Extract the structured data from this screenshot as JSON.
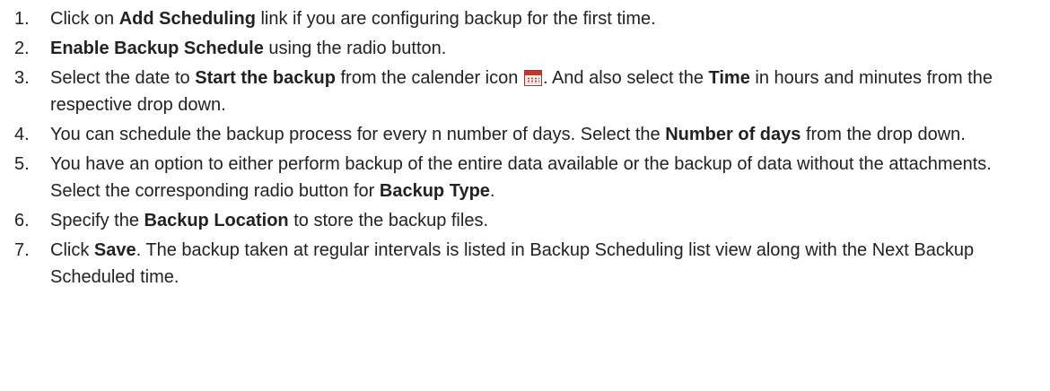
{
  "steps": [
    {
      "num": "1.",
      "parts": [
        {
          "t": "Click on "
        },
        {
          "t": "Add Scheduling",
          "b": true
        },
        {
          "t": " link if you are configuring backup for the first time."
        }
      ]
    },
    {
      "num": "2.",
      "parts": [
        {
          "t": "Enable Backup Schedule",
          "b": true
        },
        {
          "t": " using the radio button."
        }
      ]
    },
    {
      "num": "3.",
      "parts": [
        {
          "t": "Select the date to "
        },
        {
          "t": "Start the backup",
          "b": true
        },
        {
          "t": " from the calender icon "
        },
        {
          "icon": "calendar-icon"
        },
        {
          "t": ". And also select the "
        },
        {
          "t": "Time",
          "b": true
        },
        {
          "t": " in hours and minutes from the respective drop down."
        }
      ]
    },
    {
      "num": "4.",
      "parts": [
        {
          "t": "You can schedule the backup process for every n number of days. Select the "
        },
        {
          "t": "Number of days",
          "b": true
        },
        {
          "t": " from the drop down."
        }
      ]
    },
    {
      "num": "5.",
      "parts": [
        {
          "t": "You have an option to either perform backup of the entire data available or the backup of data without the attachments. Select the corresponding radio button for "
        },
        {
          "t": "Backup Type",
          "b": true
        },
        {
          "t": "."
        }
      ]
    },
    {
      "num": "6.",
      "parts": [
        {
          "t": "Specify the "
        },
        {
          "t": "Backup Location",
          "b": true
        },
        {
          "t": " to store the backup files."
        }
      ]
    },
    {
      "num": "7.",
      "parts": [
        {
          "t": "Click "
        },
        {
          "t": "Save",
          "b": true
        },
        {
          "t": ". The backup taken at regular intervals is listed in Backup Scheduling list view along with the Next Backup Scheduled time."
        }
      ]
    }
  ]
}
